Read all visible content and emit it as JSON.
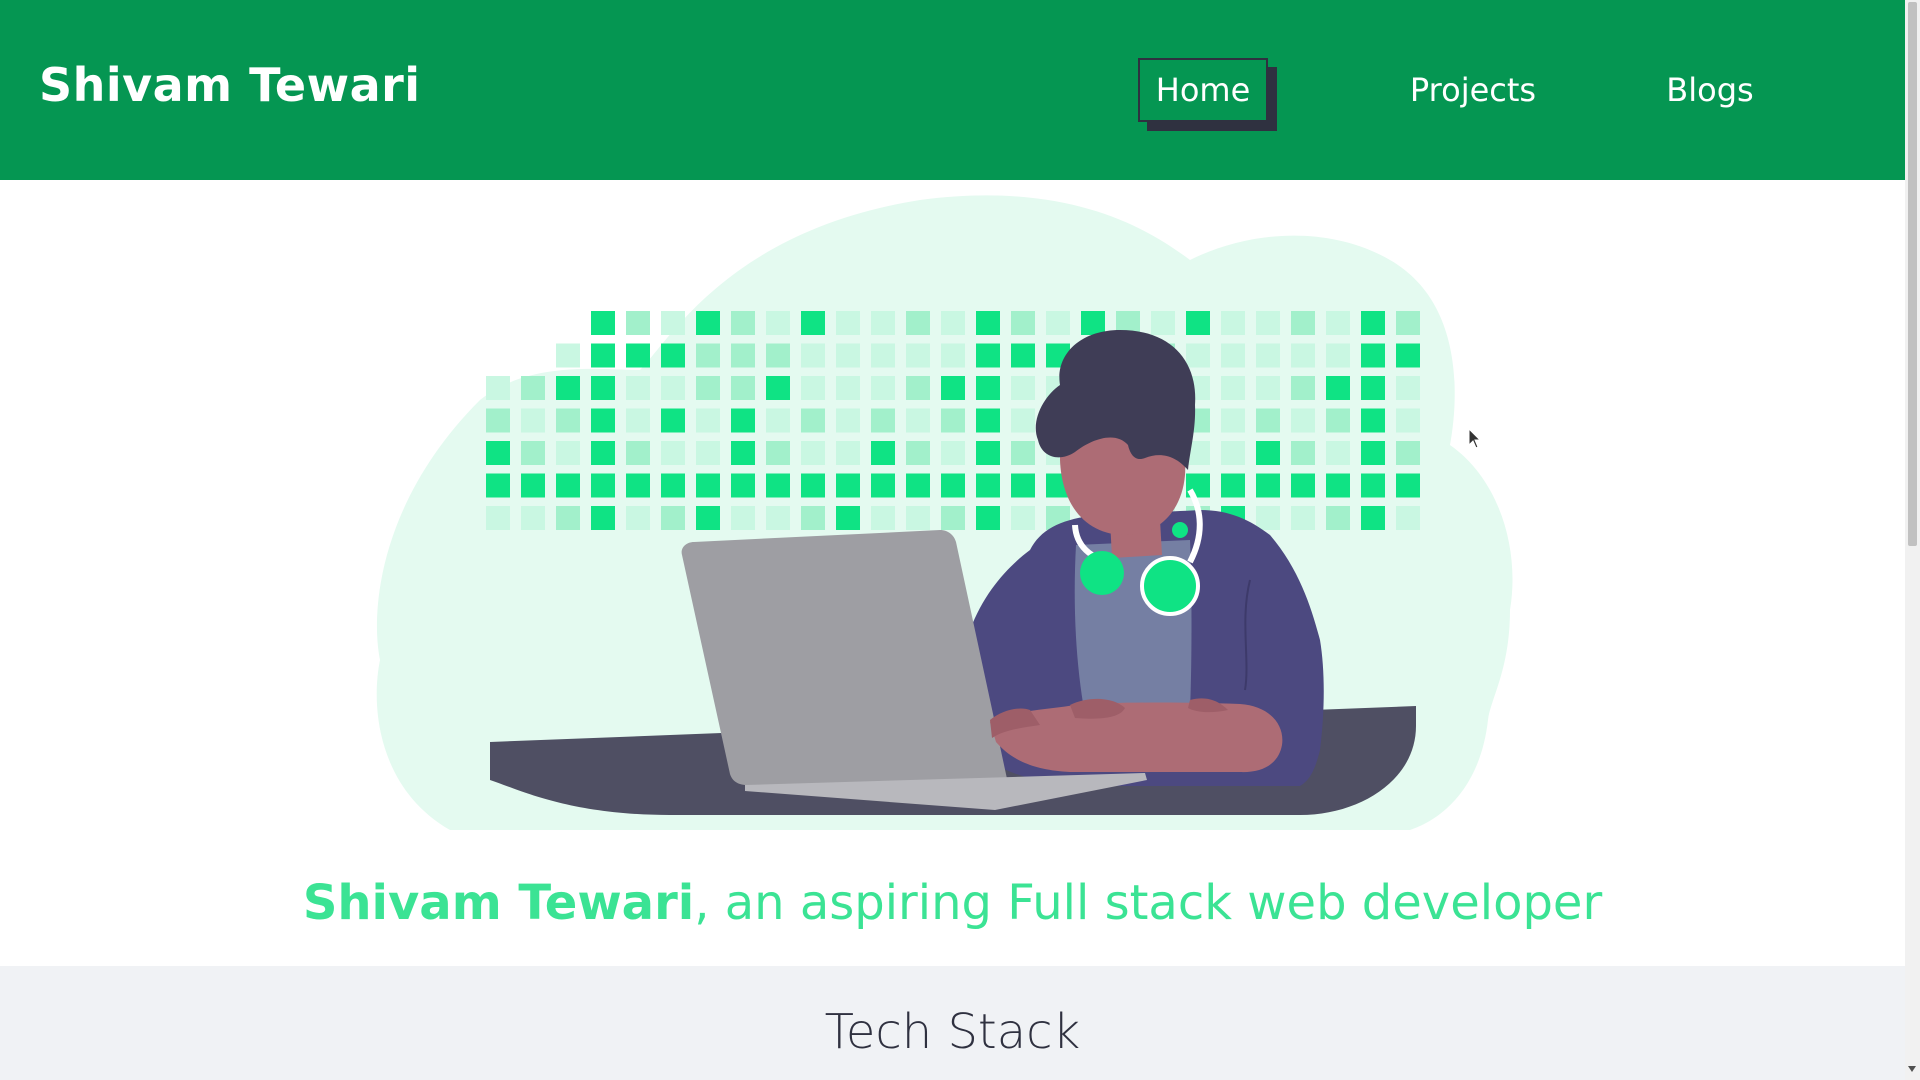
{
  "navbar": {
    "brand": "Shivam Tewari",
    "items": [
      {
        "label": "Home",
        "active": true
      },
      {
        "label": "Projects",
        "active": false
      },
      {
        "label": "Blogs",
        "active": false
      }
    ],
    "background_color": "#059652",
    "active_shadow_color": "#2f3140"
  },
  "hero": {
    "illustration": "developer-at-laptop-illustration",
    "tagline_name": "Shivam Tewari",
    "tagline_rest": ", an aspiring Full stack web developer",
    "tagline_color": "#3be394",
    "accent_color": "#0fe384"
  },
  "tech_stack": {
    "title": "Tech Stack"
  }
}
